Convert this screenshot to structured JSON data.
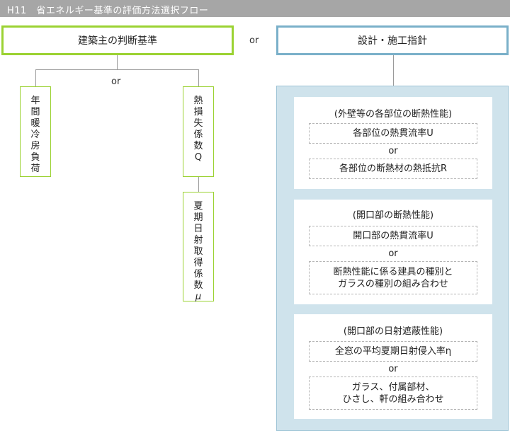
{
  "header": {
    "title": "H11　省エネルギー基準の評価方法選択フロー"
  },
  "left": {
    "heading": "建築主の判断基準",
    "or_label": "or",
    "annual_load": [
      "年",
      "間",
      "暖",
      "冷",
      "房",
      "負",
      "荷"
    ],
    "heat_loss": [
      "熱",
      "損",
      "失",
      "係",
      "数",
      "Q"
    ],
    "solar_gain": [
      "夏",
      "期",
      "日",
      "射",
      "取",
      "得",
      "係",
      "数",
      "μ"
    ]
  },
  "middle_or": "or",
  "right": {
    "heading": "設計・施工指針",
    "cards": [
      {
        "title": "(外壁等の各部位の断熱性能)",
        "option1": "各部位の熱貫流率U",
        "or_label": "or",
        "option2": "各部位の断熱材の熱抵抗R"
      },
      {
        "title": "(開口部の断熱性能)",
        "option1": "開口部の熱貫流率U",
        "or_label": "or",
        "option2_line1": "断熱性能に係る建具の種別と",
        "option2_line2": "ガラスの種別の組み合わせ"
      },
      {
        "title": "(開口部の日射遮蔽性能)",
        "option1": "全窓の平均夏期日射侵入率η",
        "or_label": "or",
        "option2_line1": "ガラス、付属部材、",
        "option2_line2": "ひさし、軒の組み合わせ"
      }
    ]
  },
  "colors": {
    "title_bar": "#a6a6a6",
    "green": "#9bd232",
    "blue": "#7ab0c9",
    "panel": "#cfe3ec"
  }
}
